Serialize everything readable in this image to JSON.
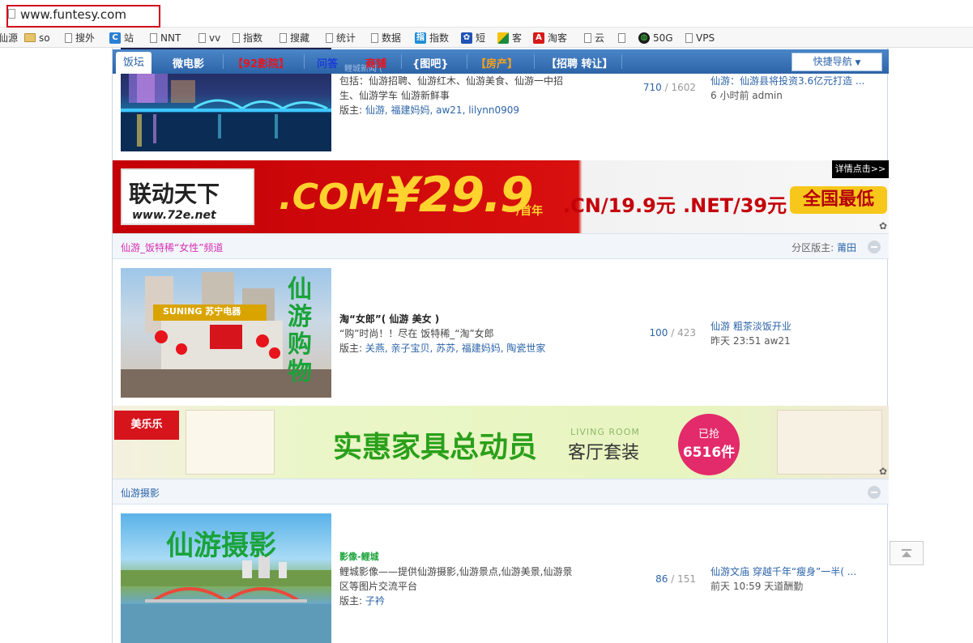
{
  "browser": {
    "url": "www.funtesy.com",
    "bookmarks": [
      {
        "label": "仙源",
        "icon": "none"
      },
      {
        "label": "so",
        "icon": "folder-icon"
      },
      {
        "label": "搜外",
        "icon": "page-icon"
      },
      {
        "label": "站",
        "icon": "site-icon"
      },
      {
        "label": "NNT",
        "icon": "page-icon"
      },
      {
        "label": "vv",
        "icon": "page-icon"
      },
      {
        "label": "指数",
        "icon": "page-icon"
      },
      {
        "label": "搜藏",
        "icon": "page-icon"
      },
      {
        "label": "统计",
        "icon": "page-icon"
      },
      {
        "label": "数据",
        "icon": "page-icon"
      },
      {
        "label": "指数",
        "icon": "index-icon"
      },
      {
        "label": "短",
        "icon": "paw-icon"
      },
      {
        "label": "客",
        "icon": "flag-icon"
      },
      {
        "label": "淘客",
        "icon": "a-icon"
      },
      {
        "label": "云",
        "icon": "page-icon"
      },
      {
        "label": "",
        "icon": "page-icon"
      },
      {
        "label": "50G",
        "icon": "globe-icon"
      },
      {
        "label": "VPS",
        "icon": "page-icon"
      }
    ]
  },
  "nav": {
    "items": [
      {
        "label": "饭坛",
        "color": "#2d64a8"
      },
      {
        "label": "微电影",
        "color": "#ffffff"
      },
      {
        "label": "【92影院】",
        "color": "#e8141c"
      },
      {
        "label": "问答",
        "color": "#1a3cd6"
      },
      {
        "label": "商铺",
        "color": "#e8141c"
      },
      {
        "label": "{图吧}",
        "color": "#ffffff"
      },
      {
        "label": "【房产】",
        "color": "#f7a21b"
      },
      {
        "label": "【招聘 转让】",
        "color": "#ffffff"
      }
    ],
    "quick_nav": "快捷导航",
    "faded_text": "鲤城新闻 ("
  },
  "forum1": {
    "desc_line1": "包括：仙游招聘、仙游红木、仙游美食、仙游一中招",
    "desc_line2": "生、仙游学车 仙游新鲜事",
    "mod_label": "版主:",
    "mods": "仙游, 福建妈妈, aw21, lilynn0909",
    "threads": "710",
    "posts": "1602",
    "last_title": "仙游：仙游县将投资3.6亿元打造 ...",
    "last_time": "6 小时前 admin"
  },
  "ad1": {
    "brand": "联动天下",
    "site": "www.72e.net",
    "com": ".COM",
    "price": "¥29.9",
    "per_year": "/首年",
    "cn": ".CN/19.9元",
    "net": ".NET/39元",
    "cta": "全国最低",
    "detail": "详情点击>>"
  },
  "section2": {
    "title": "仙游_饭特稀“女性”频道",
    "mod_label": "分区版主:",
    "mod": "莆田",
    "title_color": "#d62fb1"
  },
  "forum2": {
    "title": "淘“女郎”( 仙游 美女 )",
    "desc": "“购”时尚！！尽在 饭特稀_“淘”女郎",
    "mod_label": "版主:",
    "mods": "关燕, 亲子宝贝, 苏苏, 福建妈妈, 陶瓷世家",
    "threads": "100",
    "posts": "423",
    "last_title": "仙游 粗茶淡饭开业",
    "last_time": "昨天 23:51 aw21",
    "image_text": "仙游购物",
    "store_sign": "SUNING 苏宁电器"
  },
  "ad2": {
    "logo": "美乐乐",
    "headline": "实惠家具总动员",
    "sub_en": "LIVING ROOM",
    "sub_cn": "客厅套装",
    "badge_top": "已抢",
    "badge_num": "6516件"
  },
  "section3": {
    "title": "仙游摄影"
  },
  "forum3": {
    "title": "影像-鲤城",
    "desc_line1": "鲤城影像——提供仙游摄影,仙游景点,仙游美景,仙游景",
    "desc_line2": "区等图片交流平台",
    "mod_label": "版主:",
    "mods": "子衿",
    "threads": "86",
    "posts": "151",
    "last_title": "仙游文庙 穿越千年“瘦身”一半( ...",
    "last_time": "前天 10:59 天道酬勤",
    "image_text": "仙游摄影"
  }
}
